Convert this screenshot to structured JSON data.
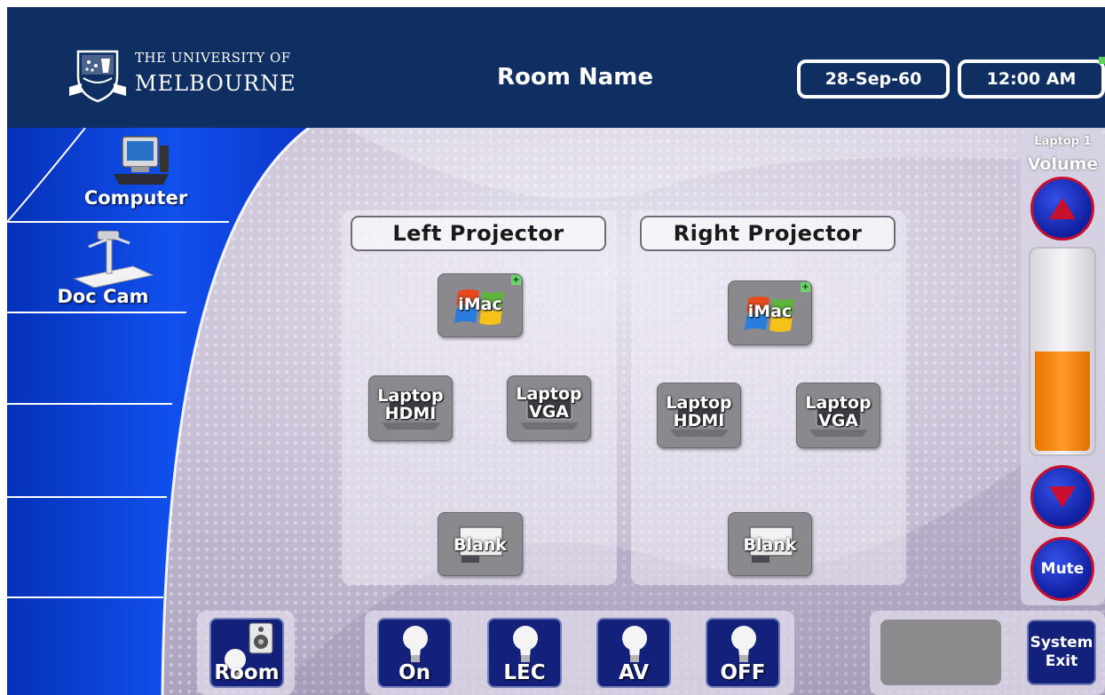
{
  "header": {
    "logo_line1": "THE UNIVERSITY OF",
    "logo_line2": "MELBOURNE",
    "room_name": "Room Name",
    "date": "28-Sep-60",
    "time": "12:00 AM"
  },
  "sidebar": {
    "items": [
      {
        "label": "Computer",
        "icon": "computer-icon"
      },
      {
        "label": "Doc Cam",
        "icon": "document-camera-icon"
      }
    ]
  },
  "projectors": {
    "left": {
      "title": "Left Projector",
      "sources": {
        "imac": "iMac",
        "laptop_hdmi_1": "Laptop",
        "laptop_hdmi_2": "HDMI",
        "laptop_vga_1": "Laptop",
        "laptop_vga_2": "VGA",
        "blank": "Blank"
      }
    },
    "right": {
      "title": "Right  Projector",
      "sources": {
        "imac": "iMac",
        "laptop_hdmi_1": "Laptop",
        "laptop_hdmi_2": "HDMI",
        "laptop_vga_1": "Laptop",
        "laptop_vga_2": "VGA",
        "blank": "Blank"
      }
    }
  },
  "volume": {
    "source": "Laptop 1",
    "title": "Volume",
    "level_percent": 50,
    "mute_label": "Mute"
  },
  "lighting": {
    "room_label": "Room",
    "presets": [
      "On",
      "LEC",
      "AV",
      "OFF"
    ]
  },
  "system": {
    "exit_label": "System\nExit"
  },
  "colors": {
    "header_navy": "#0f2f63",
    "sidebar_blue": "#0a3fd6",
    "tile_navy": "#13217a",
    "volume_orange": "#ff8c1a",
    "button_red_border": "#c8102e"
  }
}
